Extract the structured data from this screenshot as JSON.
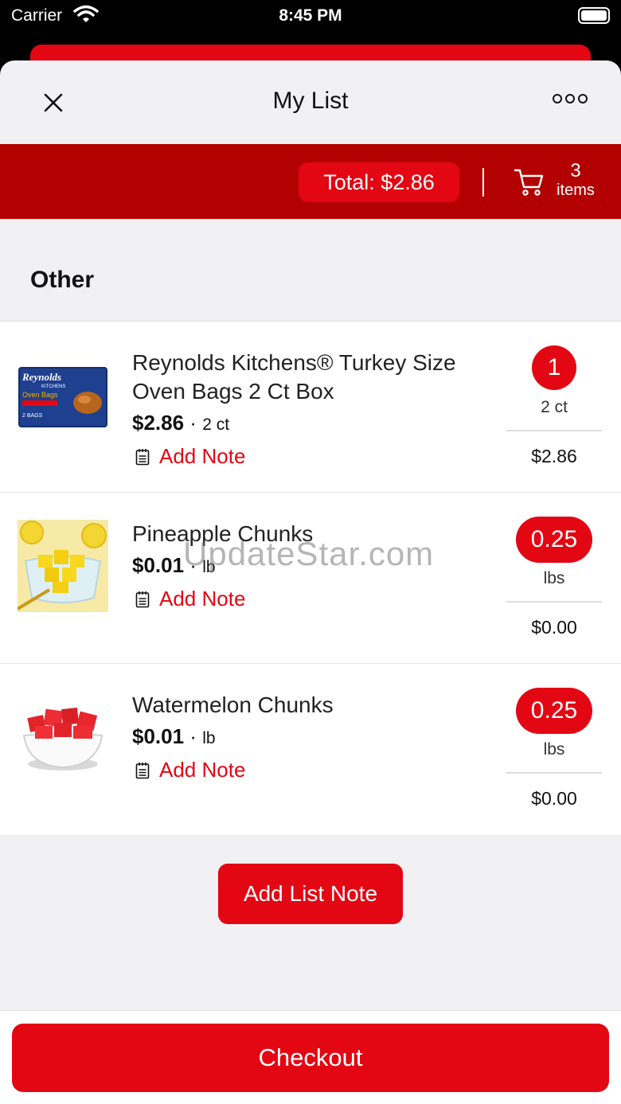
{
  "status_bar": {
    "carrier": "Carrier",
    "time": "8:45 PM"
  },
  "nav": {
    "title": "My List"
  },
  "summary": {
    "total_label": "Total: $2.86",
    "items_count": "3",
    "items_label": "items"
  },
  "section": {
    "title": "Other"
  },
  "items": [
    {
      "name": "Reynolds Kitchens® Turkey Size Oven Bags 2 Ct Box",
      "price": "$2.86",
      "unit": "2 ct",
      "note_label": "Add Note",
      "qty": "1",
      "qty_unit": "2 ct",
      "line_total": "$2.86",
      "thumbnail": "oven-bags-box-image"
    },
    {
      "name": "Pineapple Chunks",
      "price": "$0.01",
      "unit": "lb",
      "note_label": "Add Note",
      "qty": "0.25",
      "qty_unit": "lbs",
      "line_total": "$0.00",
      "thumbnail": "pineapple-chunks-image"
    },
    {
      "name": "Watermelon Chunks",
      "price": "$0.01",
      "unit": "lb",
      "note_label": "Add Note",
      "qty": "0.25",
      "qty_unit": "lbs",
      "line_total": "$0.00",
      "thumbnail": "watermelon-chunks-image"
    }
  ],
  "list_note_button": "Add List Note",
  "checkout_button": "Checkout",
  "watermark": "UpdateStar.com",
  "colors": {
    "accent": "#e30613",
    "total_bar": "#b30000",
    "background": "#f1f1f4"
  }
}
